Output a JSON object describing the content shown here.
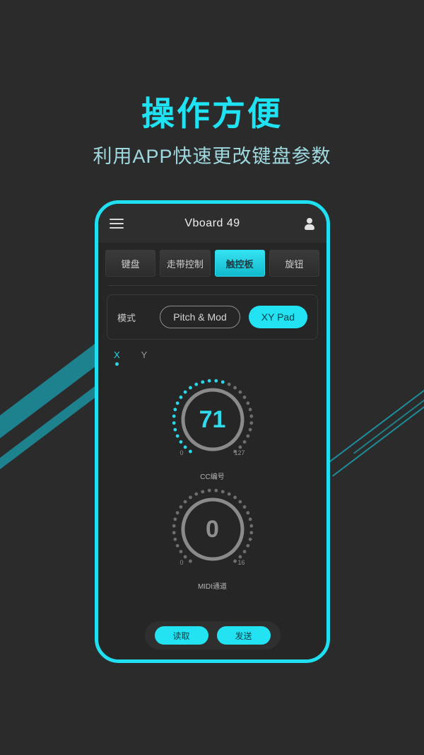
{
  "promo": {
    "headline": "操作方便",
    "subheadline": "利用APP快速更改键盘参数",
    "accent_color": "#1fe3f2",
    "background_color": "#2b2b2b"
  },
  "app": {
    "title": "Vboard 49",
    "menu_icon": "hamburger-icon",
    "account_icon": "user-icon",
    "tabs": [
      {
        "label": "键盘",
        "active": false
      },
      {
        "label": "走带控制",
        "active": false
      },
      {
        "label": "触控板",
        "active": true
      },
      {
        "label": "旋钮",
        "active": false
      }
    ],
    "mode": {
      "label": "模式",
      "options": [
        {
          "label": "Pitch & Mod",
          "active": false
        },
        {
          "label": "XY Pad",
          "active": true
        }
      ]
    },
    "axes": [
      {
        "label": "X",
        "active": true
      },
      {
        "label": "Y",
        "active": false
      }
    ],
    "knobs": [
      {
        "value": "71",
        "min": "0",
        "max": "127",
        "caption": "CC编号",
        "fill_ratio": 0.56,
        "lit": true
      },
      {
        "value": "0",
        "min": "0",
        "max": "16",
        "caption": "MIDI通道",
        "fill_ratio": 0,
        "lit": false
      }
    ],
    "actions": [
      {
        "label": "读取"
      },
      {
        "label": "发送"
      }
    ]
  }
}
